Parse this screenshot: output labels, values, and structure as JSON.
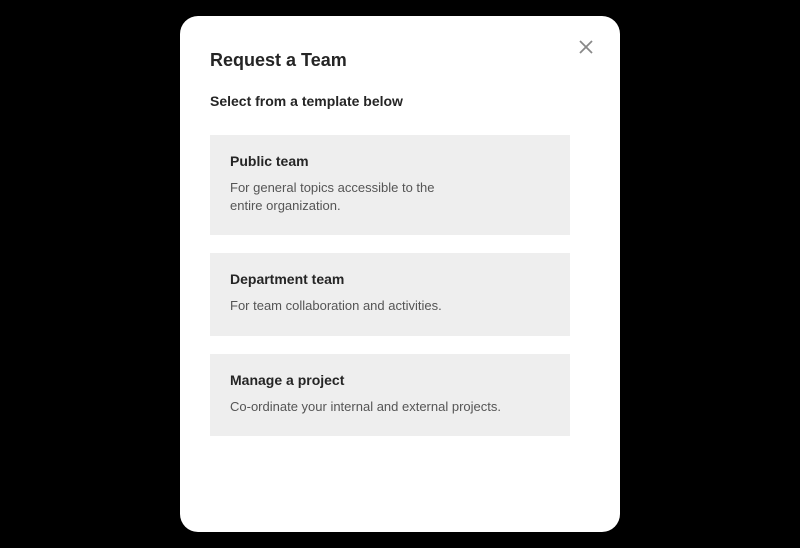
{
  "dialog": {
    "title": "Request a Team",
    "subtitle": "Select from a template below",
    "close_label": "Close"
  },
  "templates": [
    {
      "title": "Public team",
      "description": "For general topics accessible to the entire organization."
    },
    {
      "title": "Department team",
      "description": "For team collaboration and activities."
    },
    {
      "title": "Manage a project",
      "description": "Co-ordinate your internal and external projects."
    }
  ]
}
